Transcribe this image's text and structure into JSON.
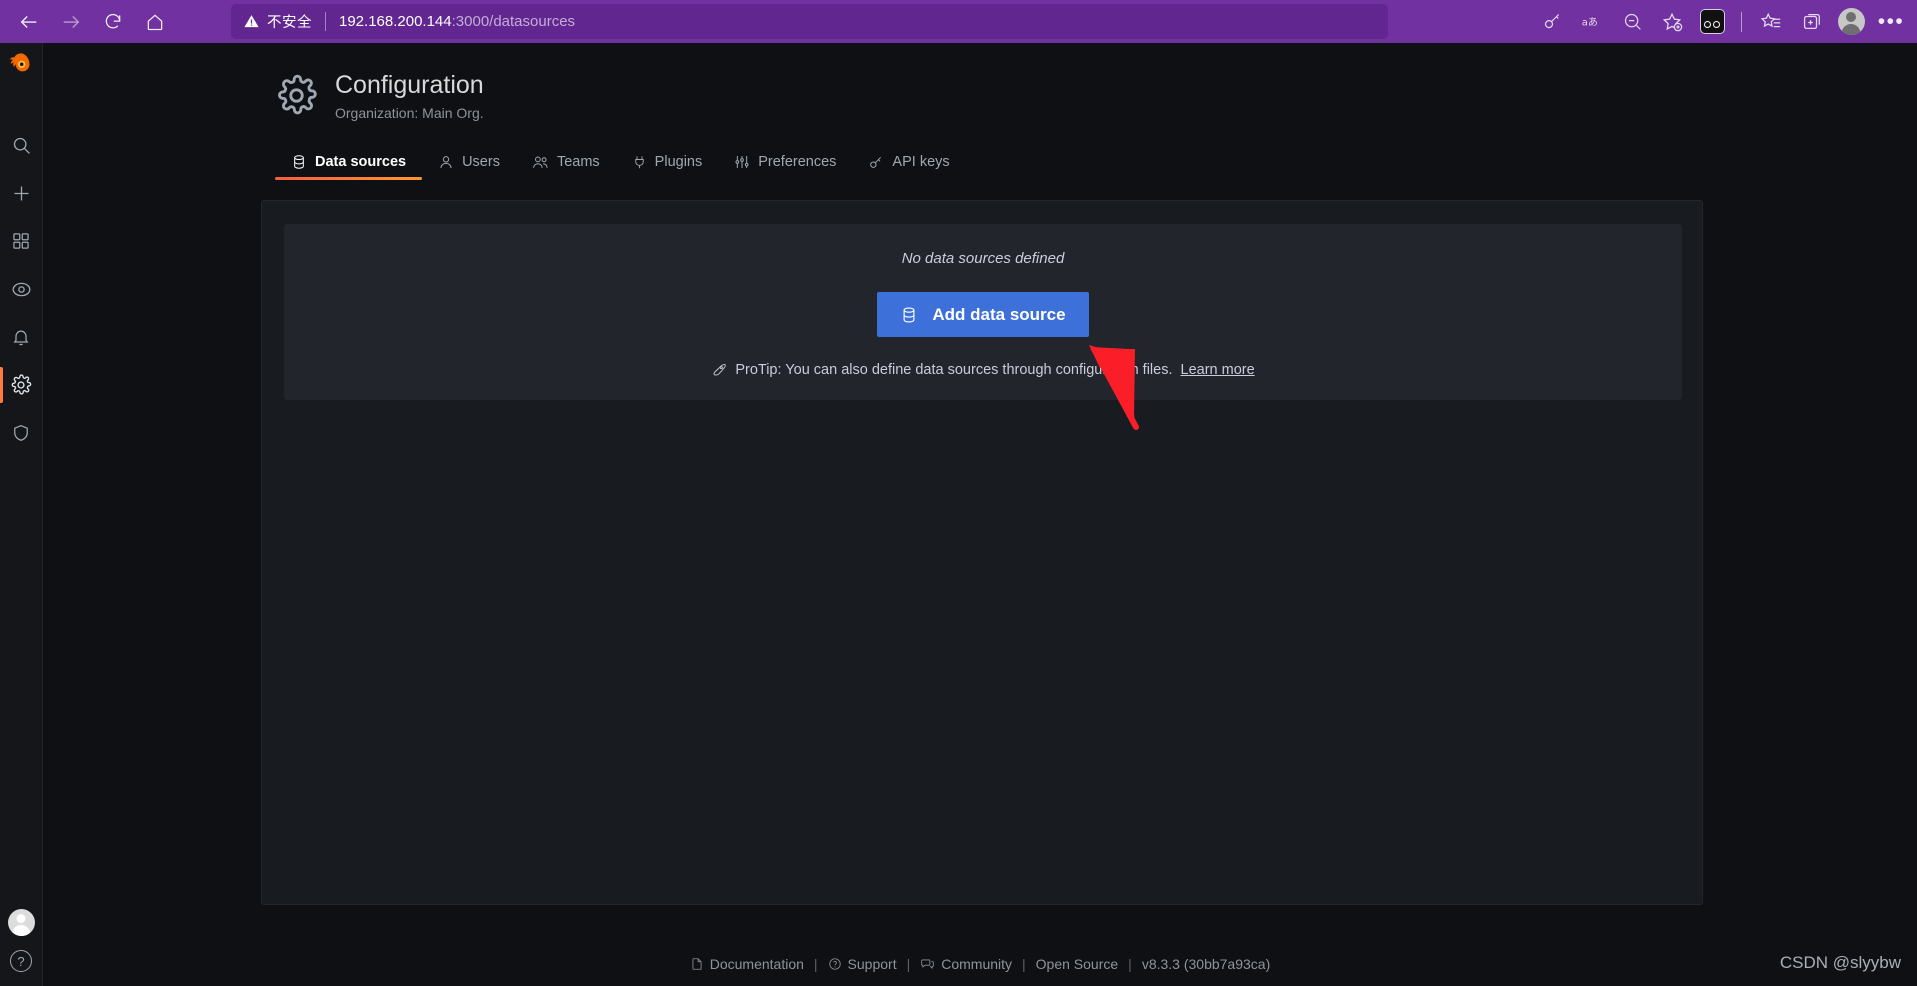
{
  "browser": {
    "back_label": "Back",
    "forward_label": "Forward",
    "refresh_label": "Refresh",
    "home_label": "Home",
    "security_label": "不安全",
    "url_host": "192.168.200.144",
    "url_path": ":3000/datasources",
    "toolbar_icons": [
      {
        "name": "key-icon",
        "label": "Password manager"
      },
      {
        "name": "translate-icon",
        "label": "aあ"
      },
      {
        "name": "zoom-out-icon",
        "label": "Zoom"
      },
      {
        "name": "add-favorite-icon",
        "label": "Add to favorites"
      },
      {
        "name": "extension-icon",
        "label": "Extension"
      },
      {
        "name": "favorites-list-icon",
        "label": "Favorites"
      },
      {
        "name": "collections-icon",
        "label": "Collections"
      },
      {
        "name": "profile-avatar",
        "label": "Profile"
      },
      {
        "name": "more-options-icon",
        "label": "Settings and more"
      }
    ]
  },
  "sidebar": {
    "brand": "grafana-logo",
    "items": [
      {
        "name": "search",
        "label": "Search"
      },
      {
        "name": "create",
        "label": "Create"
      },
      {
        "name": "dashboards",
        "label": "Dashboards"
      },
      {
        "name": "explore",
        "label": "Explore"
      },
      {
        "name": "alerting",
        "label": "Alerting"
      },
      {
        "name": "configuration",
        "label": "Configuration",
        "active": true
      },
      {
        "name": "server-admin",
        "label": "Server Admin"
      }
    ],
    "bottom": [
      {
        "name": "user-avatar",
        "label": "User"
      },
      {
        "name": "help",
        "label": "?"
      }
    ]
  },
  "header": {
    "icon": "gear-icon",
    "title": "Configuration",
    "subtitle": "Organization: Main Org."
  },
  "tabs": [
    {
      "label": "Data sources",
      "icon": "database-icon",
      "active": true
    },
    {
      "label": "Users",
      "icon": "user-icon",
      "active": false
    },
    {
      "label": "Teams",
      "icon": "users-icon",
      "active": false
    },
    {
      "label": "Plugins",
      "icon": "plug-icon",
      "active": false
    },
    {
      "label": "Preferences",
      "icon": "sliders-icon",
      "active": false
    },
    {
      "label": "API keys",
      "icon": "key-icon",
      "active": false
    }
  ],
  "empty_state": {
    "title": "No data sources defined",
    "button_label": "Add data source",
    "button_icon": "database-icon",
    "protip_icon": "rocket-icon",
    "protip_text": "ProTip: You can also define data sources through configuration files.",
    "protip_link": "Learn more"
  },
  "footer": {
    "links": [
      {
        "label": "Documentation",
        "icon": "document-icon"
      },
      {
        "label": "Support",
        "icon": "question-circle-icon"
      },
      {
        "label": "Community",
        "icon": "comments-icon"
      },
      {
        "label": "Open Source",
        "icon": ""
      }
    ],
    "separator": "|",
    "version": "v8.3.3 (30bb7a93ca)"
  },
  "watermark": "CSDN @slyybw",
  "colors": {
    "browser_chrome": "#7131a1",
    "url_pill": "#61268f",
    "page_bg": "#0e1014",
    "panel_bg": "#181b1f",
    "card_bg": "#22252b",
    "accent_orange": "#ff7941",
    "primary_blue": "#3d71d9",
    "annotation_red": "#fa1e28"
  }
}
